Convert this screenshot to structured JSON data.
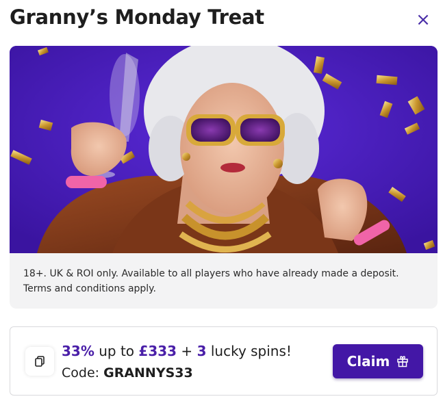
{
  "modal": {
    "title": "Granny’s Monday Treat",
    "close_icon": "close-icon",
    "close_glyph": "×"
  },
  "hero": {
    "image_subject": "elderly woman with sunglasses holding champagne glass, confetti",
    "background_color": "#4c1fc2"
  },
  "terms": {
    "line1": "18+. UK & ROI only. Available to all players who have already made a deposit.",
    "line2": "Terms and conditions apply."
  },
  "offer": {
    "copy_icon": "copy-icon",
    "percent": "33%",
    "text_a": " up to ",
    "amount": "£333",
    "text_b": " + ",
    "spins": "3",
    "text_c": " lucky spins!",
    "code_label": "Code: ",
    "code": "GRANNYS33",
    "claim_label": "Claim",
    "claim_icon": "gift-icon",
    "accent_color": "#4a1fa8",
    "button_color": "#4317a6"
  }
}
